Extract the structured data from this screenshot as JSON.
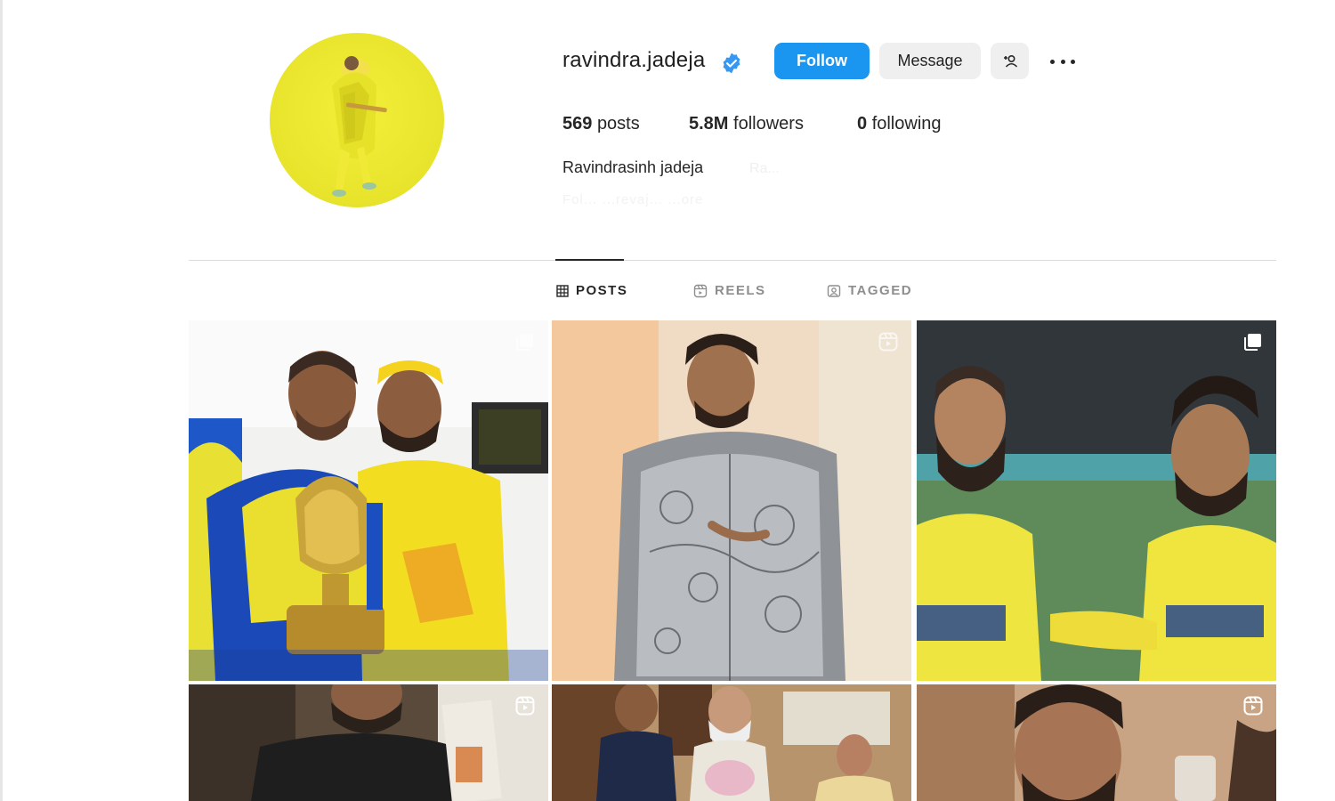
{
  "profile": {
    "username": "ravindra.jadeja",
    "verified": true,
    "full_name": "Ravindrasinh jadeja",
    "faded_text_1": "Ra...",
    "faded_text_2": "Fol... ...revaj... ...ore"
  },
  "actions": {
    "follow_label": "Follow",
    "message_label": "Message",
    "follow_color": "#1a95f0"
  },
  "stats": {
    "posts_count": "569",
    "posts_label": "posts",
    "followers_count": "5.8M",
    "followers_label": "followers",
    "following_count": "0",
    "following_label": "following"
  },
  "tabs": [
    {
      "label": "POSTS",
      "icon": "grid-icon",
      "active": true
    },
    {
      "label": "REELS",
      "icon": "reels-icon",
      "active": false
    },
    {
      "label": "TAGGED",
      "icon": "tagged-icon",
      "active": false
    }
  ],
  "posts": [
    {
      "type": "carousel",
      "icon": "carousel-icon",
      "scene": "two players in yellow jerseys holding golden trophy"
    },
    {
      "type": "reel",
      "icon": "reels-icon",
      "scene": "man in patterned grey shirt"
    },
    {
      "type": "carousel",
      "icon": "carousel-icon",
      "scene": "two cricketers in yellow jerseys on field"
    },
    {
      "type": "reel",
      "icon": "reels-icon",
      "scene": "man in black t-shirt with cricket bat"
    },
    {
      "type": "photo",
      "icon": "",
      "scene": "group photo in office with bouquet"
    },
    {
      "type": "reel",
      "icon": "reels-icon",
      "scene": "close-up portrait of bearded man"
    }
  ]
}
